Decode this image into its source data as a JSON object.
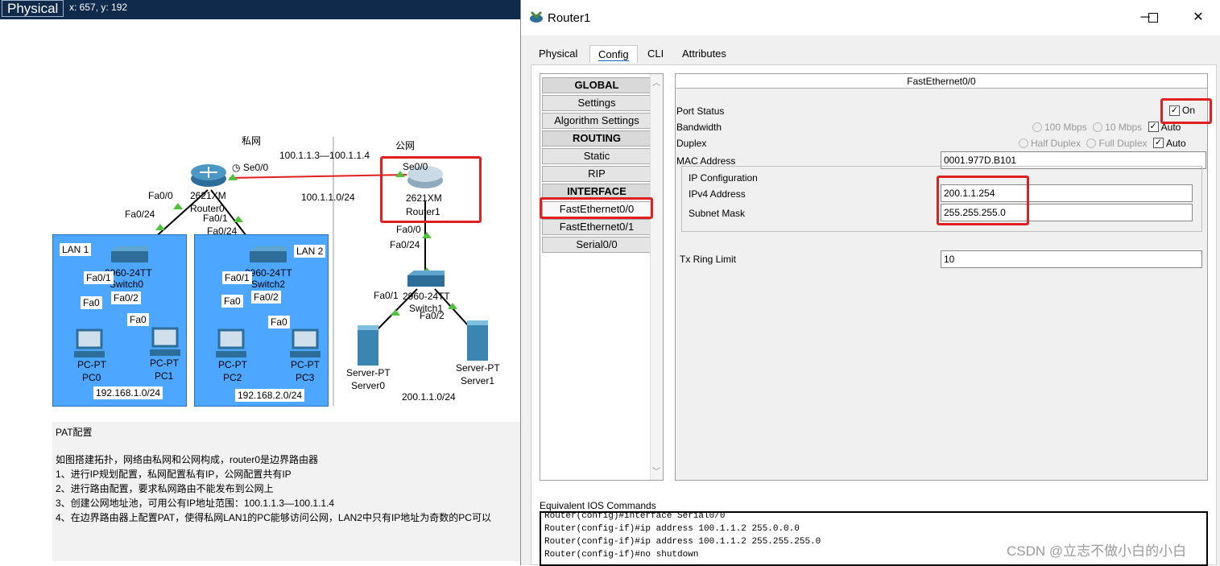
{
  "topbar": {
    "mode": "Physical",
    "coords": "x: 657, y: 192"
  },
  "topology": {
    "private_label": "私网",
    "public_label": "公网",
    "pool_range": "100.1.1.3—100.1.1.4",
    "serial_net": "100.1.1.0/24",
    "router0": {
      "model": "2621XM",
      "name": "Router0",
      "se": "Se0/0",
      "fa0": "Fa0/0",
      "fa0net": "Fa0/24",
      "fa1": "Fa0/1",
      "fa1net": "Fa0/24"
    },
    "router1": {
      "model": "2621XM",
      "name": "Router1",
      "se": "Se0/0",
      "fa0": "Fa0/0",
      "fa0net": "Fa0/24"
    },
    "lan1": {
      "label": "LAN 1",
      "switch_model": "2960-24TT",
      "switch_name": "Switch0",
      "p1": "Fa0/1",
      "p2": "Fa0/2",
      "pc0_port": "Fa0",
      "pc1_port": "Fa0",
      "pc0_type": "PC-PT",
      "pc0": "PC0",
      "pc1_type": "PC-PT",
      "pc1": "PC1",
      "net": "192.168.1.0/24"
    },
    "lan2": {
      "label": "LAN 2",
      "switch_model": "2960-24TT",
      "switch_name": "Switch2",
      "p1": "Fa0/1",
      "p2": "Fa0/2",
      "pc2_port": "Fa0",
      "pc3_port": "Fa0",
      "pc2_type": "PC-PT",
      "pc2": "PC2",
      "pc3_type": "PC-PT",
      "pc3": "PC3",
      "net": "192.168.2.0/24"
    },
    "public_switch": {
      "model": "2960-24TT",
      "name": "Switch1",
      "p1": "Fa0/1",
      "p2": "Fa0/2"
    },
    "server0": {
      "type": "Server-PT",
      "name": "Server0"
    },
    "server1": {
      "type": "Server-PT",
      "name": "Server1"
    },
    "public_net": "200.1.1.0/24"
  },
  "notes": {
    "title": "PAT配置",
    "lines": [
      "如图搭建拓扑，网络由私网和公网构成，router0是边界路由器",
      "1、进行IP规划配置，私网配置私有IP，公网配置共有IP",
      "2、进行路由配置，要求私网路由不能发布到公网上",
      "3、创建公网地址池，可用公有IP地址范围：100.1.1.3—100.1.1.4",
      "4、在边界路由器上配置PAT，使得私网LAN1的PC能够访问公网，LAN2中只有IP地址为奇数的PC可以"
    ]
  },
  "window": {
    "title": "Router1",
    "tabs": [
      "Physical",
      "Config",
      "CLI",
      "Attributes"
    ],
    "active_tab": "Config",
    "left_list": [
      {
        "label": "GLOBAL",
        "head": true
      },
      {
        "label": "Settings"
      },
      {
        "label": "Algorithm Settings"
      },
      {
        "label": "ROUTING",
        "head": true
      },
      {
        "label": "Static"
      },
      {
        "label": "RIP"
      },
      {
        "label": "INTERFACE",
        "head": true
      },
      {
        "label": "FastEthernet0/0",
        "selected": true
      },
      {
        "label": "FastEthernet0/1"
      },
      {
        "label": "Serial0/0"
      }
    ],
    "interface": {
      "header": "FastEthernet0/0",
      "port_status_label": "Port Status",
      "on_label": "On",
      "bandwidth_label": "Bandwidth",
      "bw_100": "100 Mbps",
      "bw_10": "10 Mbps",
      "auto1": "Auto",
      "duplex_label": "Duplex",
      "half": "Half Duplex",
      "full": "Full Duplex",
      "auto2": "Auto",
      "mac_label": "MAC Address",
      "mac": "0001.977D.B101",
      "ip_config_label": "IP Configuration",
      "ipv4_label": "IPv4 Address",
      "ipv4": "200.1.1.254",
      "mask_label": "Subnet Mask",
      "mask": "255.255.255.0",
      "tx_label": "Tx Ring Limit",
      "tx": "10"
    },
    "ios_label": "Equivalent IOS Commands",
    "ios_lines": [
      "Router(config)#interface Serial0/0",
      "Router(config-if)#ip address 100.1.1.2 255.0.0.0",
      "Router(config-if)#ip address 100.1.1.2 255.255.255.0",
      "Router(config-if)#no shutdown"
    ]
  },
  "watermark": "CSDN @立志不做小白的小白"
}
